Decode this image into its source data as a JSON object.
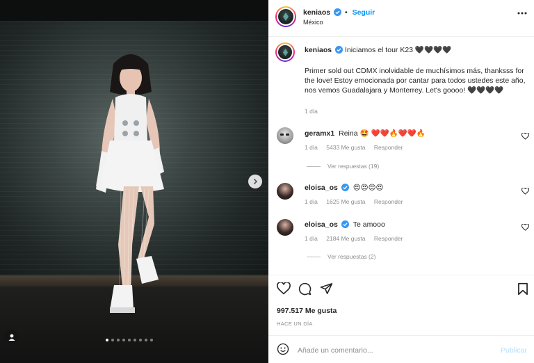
{
  "header": {
    "username": "keniaos",
    "follow_label": "Seguir",
    "separator": "•",
    "location": "México"
  },
  "caption": {
    "username": "keniaos",
    "title": "Iniciamos el tour K23 🖤🖤🖤🖤",
    "body": "Primer sold out CDMX inolvidable de muchísimos más, thanksss for the love! Estoy emocionada por cantar para todos ustedes este año, nos vemos Guadalajara y Monterrey. Let's goooo! 🖤🖤🖤🖤",
    "time": "1 día"
  },
  "comments": [
    {
      "username": "geramx1",
      "text": "Reina 🤩 ❤️❤️🔥❤️❤️🔥",
      "time": "1 día",
      "likes": "5433 Me gusta",
      "reply": "Responder",
      "view_replies": "Ver respuestas (19)"
    },
    {
      "username": "eloisa_os",
      "text": "😍😍😍😍",
      "time": "1 día",
      "likes": "1625 Me gusta",
      "reply": "Responder"
    },
    {
      "username": "eloisa_os",
      "text": "Te amooo",
      "time": "1 día",
      "likes": "2184 Me gusta",
      "reply": "Responder",
      "view_replies": "Ver respuestas (2)"
    }
  ],
  "stats": {
    "likes": "997.517 Me gusta",
    "ago": "HACE UN DÍA"
  },
  "composer": {
    "placeholder": "Añade un comentario...",
    "publish": "Publicar"
  },
  "carousel": {
    "total": 9,
    "current": 1
  },
  "colors": {
    "accent": "#0095f6",
    "verified": "#3897f0",
    "muted": "#8e8e8e",
    "publish_disabled": "#b2dffc"
  },
  "icons": [
    "more-icon",
    "verified-icon",
    "heart-icon",
    "comment-icon",
    "share-icon",
    "bookmark-icon",
    "emoji-icon",
    "chevron-right-icon",
    "user-tag-icon"
  ]
}
